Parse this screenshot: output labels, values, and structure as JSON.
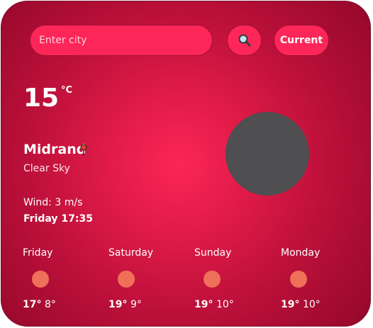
{
  "search": {
    "placeholder": "Enter city",
    "value": ""
  },
  "buttons": {
    "search_icon": "search-icon",
    "current_label": "Current"
  },
  "current": {
    "temperature": "15",
    "unit": "°C",
    "city": "Midrand",
    "condition": "Clear Sky",
    "wind": "Wind: 3 m/s",
    "day_time": "Friday 17:35",
    "weather_icon": "moon-icon"
  },
  "forecast": [
    {
      "day": "Friday",
      "high": "17°",
      "low": "8°"
    },
    {
      "day": "Saturday",
      "high": "19°",
      "low": "9°"
    },
    {
      "day": "Sunday",
      "high": "19°",
      "low": "10°"
    },
    {
      "day": "Monday",
      "high": "19°",
      "low": "10°"
    }
  ],
  "colors": {
    "card_center": "#fb2656",
    "card_edge": "#94082a",
    "moon": "#4f4e50",
    "forecast_sun": "#ef7058"
  }
}
